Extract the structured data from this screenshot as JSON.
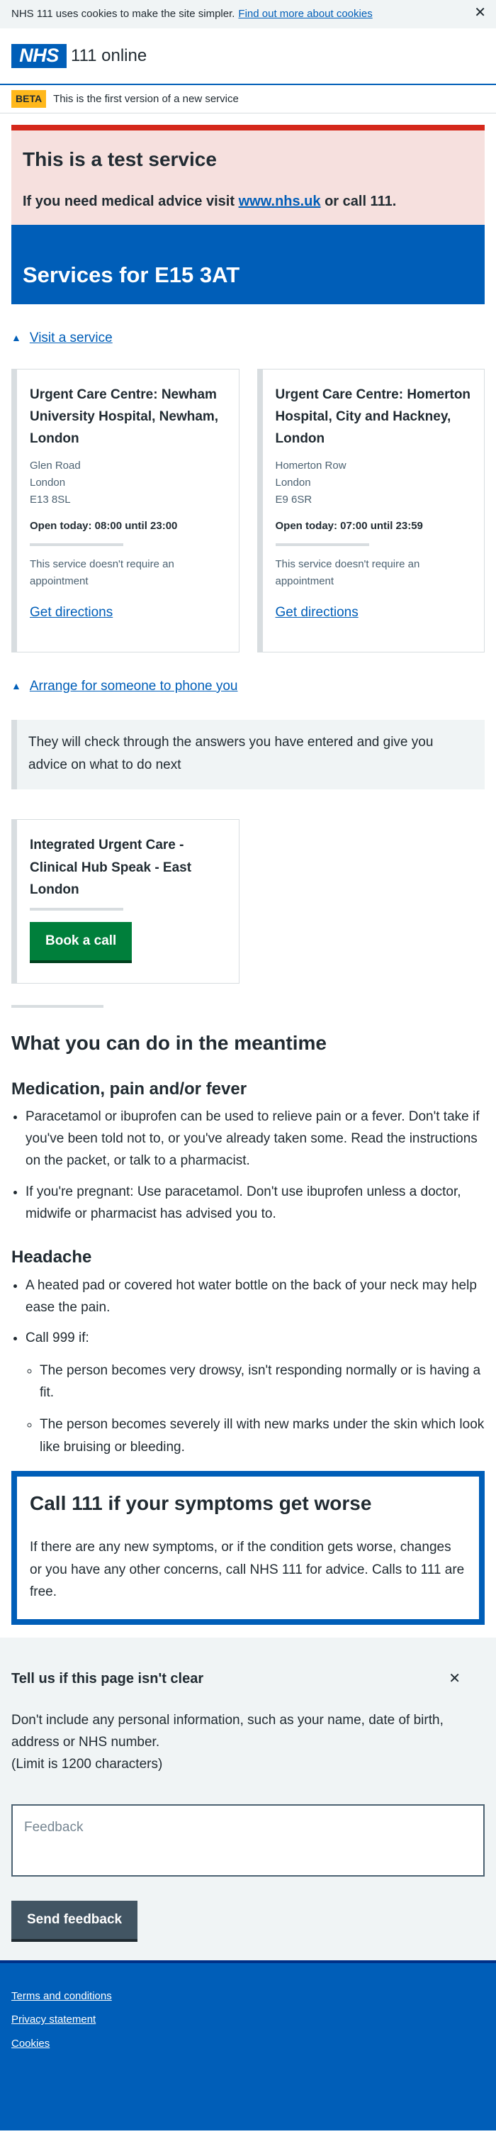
{
  "cookie_banner": {
    "text": "NHS 111 uses cookies to make the site simpler.",
    "link": "Find out more about cookies",
    "close_icon": "close-icon"
  },
  "header": {
    "logo_text": "NHS",
    "service_name": "111 online"
  },
  "beta": {
    "tag": "BETA",
    "text": "This is the first version of a new service"
  },
  "test_service": {
    "title": "This is a test service",
    "advice_prefix": "If you need medical advice visit",
    "advice_link": "www.nhs.uk",
    "advice_suffix": "or call 111."
  },
  "services_title": "Services for E15 3AT",
  "visit_service_link": "Visit a service",
  "services": [
    {
      "name": "Urgent Care Centre: Newham University Hospital, Newham, London",
      "address": [
        "Glen Road",
        "London",
        "E13 8SL"
      ],
      "opening": "Open today: 08:00 until 23:00",
      "note": "This service doesn't require an appointment",
      "directions": "Get directions"
    },
    {
      "name": "Urgent Care Centre: Homerton Hospital, City and Hackney, London",
      "address": [
        "Homerton Row",
        "London",
        "E9 6SR"
      ],
      "opening": "Open today: 07:00 until 23:59",
      "note": "This service doesn't require an appointment",
      "directions": "Get directions"
    }
  ],
  "arrange_call_link": "Arrange for someone to phone you",
  "inset_text": "They will check through the answers you have entered and give you advice on what to do next",
  "call_service": {
    "name": "Integrated Urgent Care - Clinical Hub Speak - East London",
    "button": "Book a call"
  },
  "meantime": {
    "title": "What you can do in the meantime",
    "sections": [
      {
        "heading": "Medication, pain and/or fever",
        "items": [
          "Paracetamol or ibuprofen can be used to relieve pain or a fever. Don't take if you've been told not to, or you've already taken some. Read the instructions on the packet, or talk to a pharmacist.",
          "If you're pregnant: Use paracetamol. Don't use ibuprofen unless a doctor, midwife or pharmacist has advised you to."
        ]
      },
      {
        "heading": "Headache",
        "items": [
          "A heated pad or covered hot water bottle on the back of your neck may help ease the pain.",
          "Call 999 if:"
        ],
        "sub_items": [
          "The person becomes very drowsy, isn't responding normally or is having a fit.",
          "The person becomes severely ill with new marks under the skin which look like bruising or bleeding."
        ]
      }
    ]
  },
  "care_card": {
    "title": "Call 111 if your symptoms get worse",
    "text": "If there are any new symptoms, or if the condition gets worse, changes or you have any other concerns, call NHS 111 for advice. Calls to 111 are free."
  },
  "feedback": {
    "title": "Tell us if this page isn't clear",
    "close_icon": "close-icon",
    "text": "Don't include any personal information, such as your name, date of birth, address or NHS number.",
    "limit": "(Limit is 1200 characters)",
    "placeholder": "Feedback",
    "button": "Send feedback"
  },
  "footer": {
    "links": [
      "Terms and conditions",
      "Privacy statement",
      "Cookies"
    ]
  },
  "colors": {
    "nhs_blue": "#005eb8",
    "green": "#007f3b",
    "red": "#d5281b",
    "beta_yellow": "#ffb81c"
  }
}
